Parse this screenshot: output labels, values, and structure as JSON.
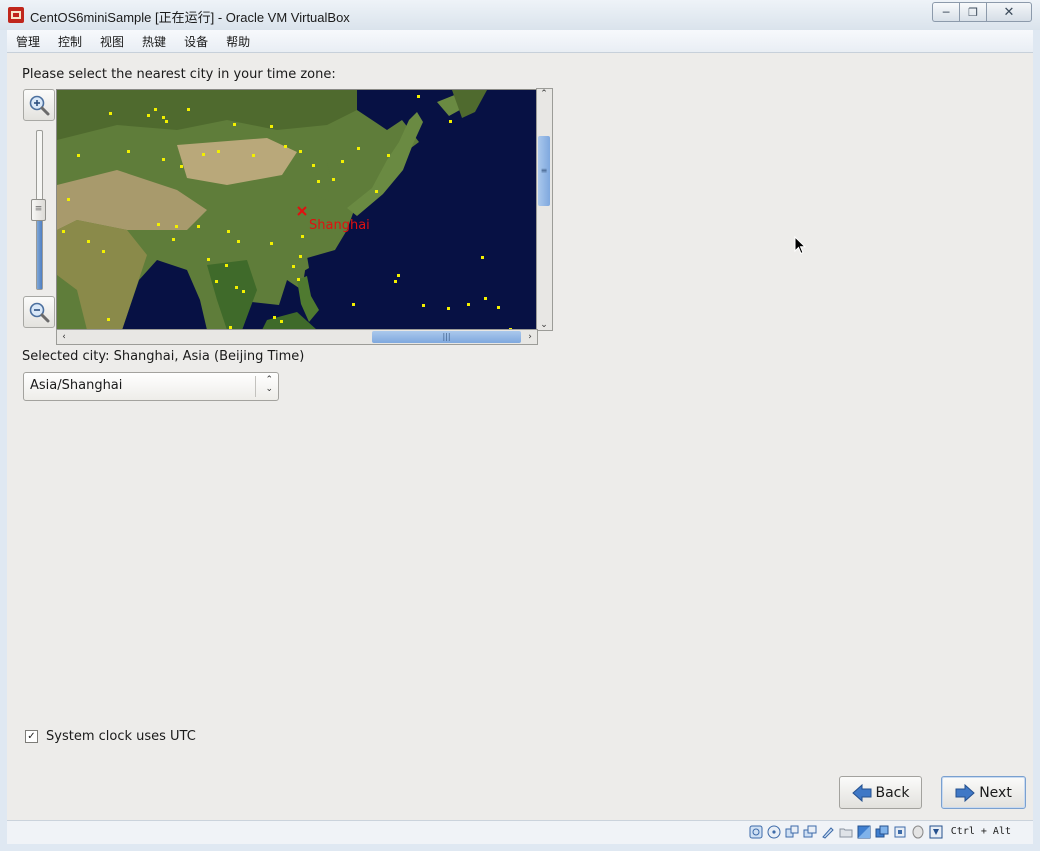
{
  "window": {
    "title": "CentOS6miniSample [正在运行] - Oracle VM VirtualBox",
    "controls": [
      "minimize-icon",
      "restore-icon",
      "close-icon"
    ]
  },
  "menubar": {
    "items": [
      "管理",
      "控制",
      "视图",
      "热键",
      "设备",
      "帮助"
    ]
  },
  "timezone": {
    "prompt": "Please select the nearest city in your time zone:",
    "map": {
      "highlighted_city": "Shanghai",
      "colors": {
        "ocean": "#071144",
        "land": "#5f7d3a",
        "city_dot": "#f2f000",
        "selected_city": "#e01010"
      }
    },
    "zoom_level": 0.5,
    "selected_city_text": "Selected city: Shanghai, Asia (Beijing Time)",
    "select_value": "Asia/Shanghai",
    "utc_checkbox": {
      "label": "System clock uses UTC",
      "checked": true
    }
  },
  "buttons": {
    "back_label": "Back",
    "next_label": "Next"
  },
  "statusbar": {
    "host_key": "Ctrl + Alt",
    "icons": [
      "hard-disk-icon",
      "optical-drive-icon",
      "audio-icon",
      "network-icon",
      "usb-icon",
      "shared-folder-icon",
      "display-icon",
      "video-capture-icon",
      "cpu-icon",
      "mouse-integration-icon",
      "keyboard-capture-icon"
    ]
  }
}
